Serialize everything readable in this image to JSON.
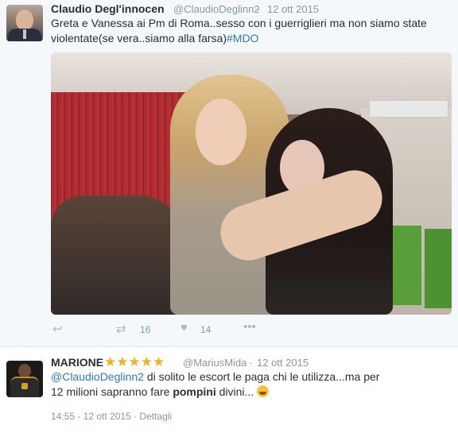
{
  "tweet1": {
    "name": "Claudio Degl'innocen",
    "handle": "@ClaudioDeglinn2",
    "separator": "·",
    "date": "12 ott 2015",
    "text_part1": "Greta e Vanessa ai Pm di Roma..sesso con i guerriglieri ma non siamo state violentate(se vera..siamo alla farsa)",
    "hashtag": "#MDO",
    "actions": {
      "reply_icon": "reply-icon",
      "retweet_icon": "retweet-icon",
      "retweet_count": "16",
      "like_icon": "heart-icon",
      "like_count": "14",
      "more_icon": "more-icon"
    }
  },
  "tweet2": {
    "name": "MARIONE",
    "stars": "★★★★★",
    "handle": "@MariusMida",
    "separator": "·",
    "date": "12 ott 2015",
    "mention": "@ClaudioDeglinn2",
    "text_part1": " di solito le escort le paga chi le utilizza...ma per 12 milioni sapranno fare ",
    "bold_word": "pompini",
    "text_part2": " divini...",
    "emoji": "face-with-tears-of-joy",
    "footer": "14:55 - 12 ott 2015 · Dettagli"
  },
  "colors": {
    "link": "#2b7bb9",
    "muted": "#8899a6",
    "text": "#292f33",
    "star": "#f2b01e",
    "tweet_bg": "#f5f8fa"
  }
}
